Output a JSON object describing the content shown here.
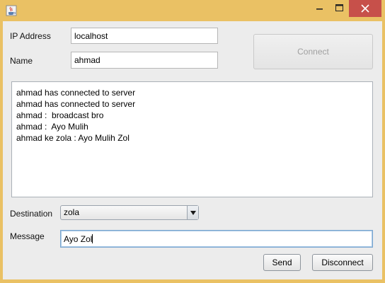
{
  "window": {
    "icon": "java-coffee-icon",
    "controls": {
      "minimize": "minimize-icon",
      "maximize": "maximize-icon",
      "close": "close-icon"
    },
    "colors": {
      "frame": "#eac164",
      "close_button": "#c7504a",
      "client_background": "#ececec"
    }
  },
  "form": {
    "ip_label": "IP Address",
    "ip_value": "localhost",
    "name_label": "Name",
    "name_value": "ahmad",
    "connect_label": "Connect"
  },
  "chat": {
    "lines": [
      "ahmad has connected to server",
      "ahmad has connected to server",
      "ahmad :  broadcast bro",
      "ahmad :  Ayo Mulih",
      "ahmad ke zola : Ayo Mulih Zol"
    ]
  },
  "destination": {
    "label": "Destination",
    "selected": "zola",
    "arrow_icon": "chevron-down-icon"
  },
  "message": {
    "label": "Message",
    "value": "Ayo Zol"
  },
  "actions": {
    "send_label": "Send",
    "disconnect_label": "Disconnect"
  }
}
